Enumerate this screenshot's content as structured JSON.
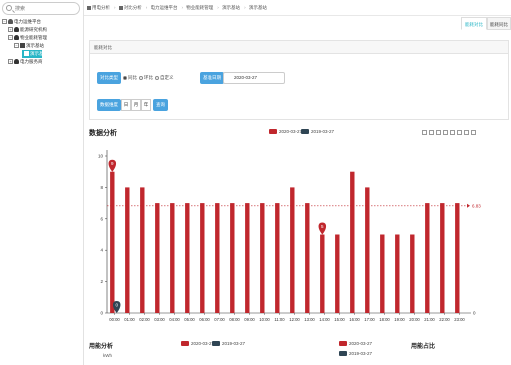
{
  "search": {
    "placeholder": "搜索"
  },
  "tree": [
    {
      "label": "电力运维平台",
      "toggle": "−",
      "icon": "cloud-icon",
      "level": 0
    },
    {
      "label": "能源研究机构",
      "toggle": "+",
      "icon": "person-icon",
      "level": 1
    },
    {
      "label": "物业能耗管理",
      "toggle": "−",
      "icon": "person-icon",
      "level": 1
    },
    {
      "label": "演示基站",
      "toggle": "−",
      "icon": "folder-icon",
      "level": 2
    },
    {
      "label": "演示基站",
      "toggle": "",
      "icon": "pin-icon",
      "level": 3,
      "active": true
    },
    {
      "label": "电力服务商",
      "toggle": "+",
      "icon": "person-icon",
      "level": 1
    }
  ],
  "breadcrumb": [
    "用电分析",
    "对比分析",
    "电力运维平台",
    "物业能耗管理",
    "演示基站",
    "演示基站"
  ],
  "tabs": {
    "tab1": "能耗对比",
    "tab2": "能耗同比"
  },
  "panel": {
    "title": "能耗对比",
    "compare_type_label": "对比类型",
    "radio_options": [
      "同比",
      "环比",
      "自定义"
    ],
    "base_date_label": "基准日期",
    "base_date_value": "2020-03-27",
    "dimension_label": "数据维度",
    "dimension_options": [
      "日",
      "月",
      "年"
    ],
    "query_label": "查询"
  },
  "chart_section": {
    "title": "数据分析",
    "legend_current": "2020-03-27",
    "legend_previous": "2019-03-27",
    "toolbox": [
      "data-zoom-icon",
      "zoom-reset-icon",
      "data-view-icon",
      "line-chart-icon",
      "bar-chart-icon",
      "stack-icon",
      "restore-icon",
      "download-icon"
    ]
  },
  "chart_data": {
    "type": "bar",
    "categories": [
      "00:00",
      "01:00",
      "02:00",
      "03:00",
      "04:00",
      "05:00",
      "06:00",
      "07:00",
      "08:00",
      "09:00",
      "10:00",
      "11:00",
      "12:00",
      "13:00",
      "14:00",
      "15:00",
      "16:00",
      "17:00",
      "18:00",
      "19:00",
      "20:00",
      "21:00",
      "22:00",
      "23:00"
    ],
    "series": [
      {
        "name": "2020-03-27",
        "values": [
          9,
          8,
          8,
          7,
          7,
          7,
          7,
          7,
          7,
          7,
          7,
          7,
          8,
          7,
          5,
          5,
          9,
          8,
          5,
          5,
          5,
          7,
          7,
          7
        ],
        "color": "#c0272d"
      },
      {
        "name": "2019-03-27",
        "values": [
          0,
          0,
          0,
          0,
          0,
          0,
          0,
          0,
          0,
          0,
          0,
          0,
          0,
          0,
          0,
          0,
          0,
          0,
          0,
          0,
          0,
          0,
          0,
          0
        ],
        "color": "#2f4554"
      }
    ],
    "yticks": [
      0,
      2,
      4,
      6,
      8,
      10
    ],
    "ylim": [
      0,
      10
    ],
    "markpoints": [
      {
        "label": "9",
        "category": "00:00",
        "value": 9,
        "series": "2020-03-27"
      },
      {
        "label": "5",
        "category": "14:00",
        "value": 5,
        "series": "2020-03-27"
      },
      {
        "label": "0",
        "category": "00:00",
        "value": 0,
        "series": "2019-03-27"
      }
    ],
    "markline": {
      "label": "6.83",
      "value": 6.83
    },
    "axis_end_label": "0",
    "grid": false,
    "legend_position": "top-center"
  },
  "bottom": {
    "usage_title": "用能分析",
    "usage_unit": "kWh",
    "legend_a_current": "2020-03-27",
    "legend_a_previous": "2019-03-27",
    "legend_b_current": "2020-03-27",
    "legend_b_previous": "2019-03-27",
    "ratio_title": "用能占比"
  },
  "colors": {
    "accent": "#4aa3df",
    "active_tree": "#29b6c6",
    "bar_current": "#c0272d",
    "bar_previous": "#2f4554"
  }
}
